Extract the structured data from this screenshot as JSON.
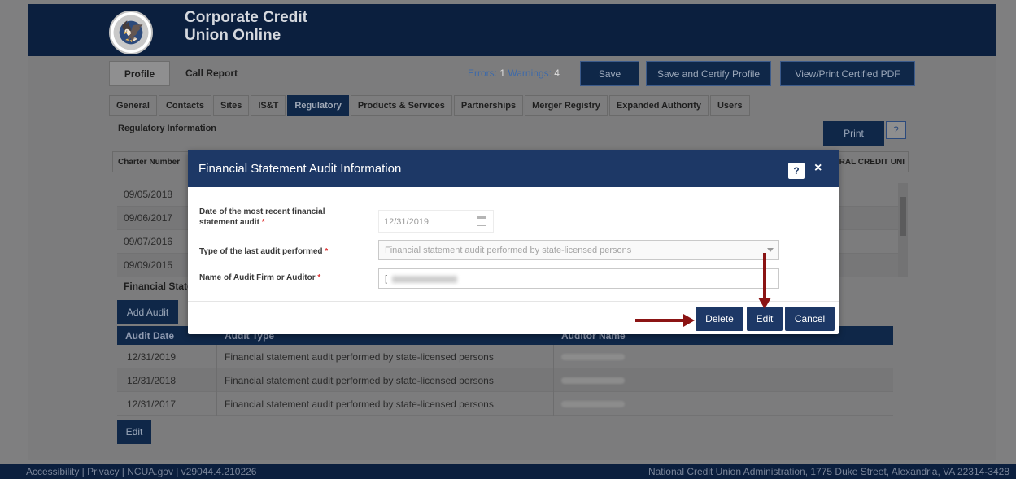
{
  "app": {
    "title": "Corporate Credit Union Online"
  },
  "toolbar": {
    "profile_label": "Profile",
    "call_report_label": "Call Report",
    "errors_label": "Errors:",
    "errors_count": "1",
    "warnings_label": "Warnings:",
    "warnings_count": "4",
    "save_label": "Save",
    "save_certify_label": "Save and Certify Profile",
    "view_print_label": "View/Print Certified PDF"
  },
  "tabs": [
    "General",
    "Contacts",
    "Sites",
    "IS&T",
    "Regulatory",
    "Products & Services",
    "Partnerships",
    "Merger Registry",
    "Expanded Authority",
    "Users"
  ],
  "active_tab": "Regulatory",
  "regulatory": {
    "section_label": "Regulatory Information",
    "print_label": "Print",
    "help_label": "?",
    "charter_label": "Charter Number",
    "charter_right": "RAL CREDIT UNI",
    "dates": [
      "09/05/2018",
      "09/06/2017",
      "09/07/2016",
      "09/09/2015"
    ]
  },
  "financial": {
    "section_label": "Financial State",
    "add_audit_label": "Add Audit",
    "columns": [
      "Audit Date",
      "Audit Type",
      "Auditor Name"
    ],
    "rows": [
      {
        "date": "12/31/2019",
        "type": "Financial statement audit performed by state-licensed persons"
      },
      {
        "date": "12/31/2018",
        "type": "Financial statement audit performed by state-licensed persons"
      },
      {
        "date": "12/31/2017",
        "type": "Financial statement audit performed by state-licensed persons"
      }
    ],
    "edit_label": "Edit"
  },
  "modal": {
    "title": "Financial Statement Audit Information",
    "help_label": "?",
    "close_label": "×",
    "date_label": "Date of the most recent financial statement audit",
    "date_value": "12/31/2019",
    "type_label": "Type of the last audit performed",
    "type_value": "Financial statement audit performed by state-licensed persons",
    "name_label": "Name of Audit Firm or Auditor",
    "name_value_prefix": "[",
    "required_mark": "*",
    "delete_label": "Delete",
    "edit_label": "Edit",
    "cancel_label": "Cancel"
  },
  "footer": {
    "links": "Accessibility | Privacy | NCUA.gov | v29044.4.210226",
    "address": "National Credit Union Administration, 1775 Duke Street, Alexandria, VA 22314-3428"
  },
  "icons": {
    "seal": "ncua-seal-icon",
    "calendar": "calendar-icon",
    "select": "chevron-down-icon",
    "annotation": "red-arrow-icon"
  },
  "colors": {
    "navy": "#0b1f3e",
    "modal_header": "#1d3866",
    "annotation_red": "#8b1414",
    "required_red": "#dd3333"
  }
}
